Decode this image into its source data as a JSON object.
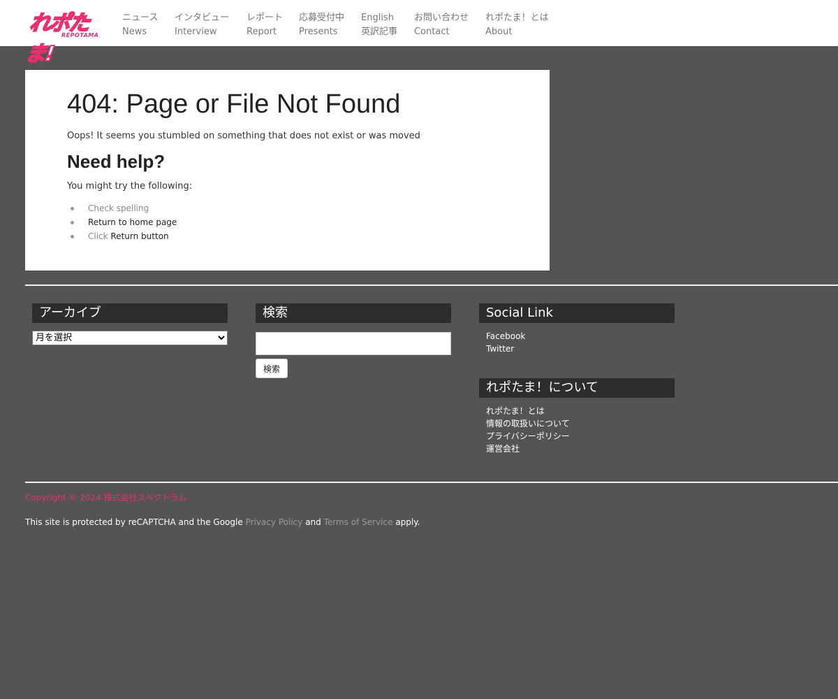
{
  "header": {
    "logo_text": "れポたま!",
    "logo_sub": "REPOTAMA",
    "nav": [
      {
        "jp": "ニュース",
        "en": "News"
      },
      {
        "jp": "インタビュー",
        "en": "Interview"
      },
      {
        "jp": "レポート",
        "en": "Report"
      },
      {
        "jp": "応募受付中",
        "en": "Presents"
      },
      {
        "jp": "English",
        "en": "英訳記事"
      },
      {
        "jp": "お問い合わせ",
        "en": "Contact"
      },
      {
        "jp": "れポたま！とは",
        "en": "About"
      }
    ]
  },
  "main": {
    "title": "404: Page or File Not Found",
    "oops": "Oops! It seems you stumbled on something that does not exist or was moved",
    "help_title": "Need help?",
    "try_text": "You might try the following:",
    "suggestions": [
      {
        "text": "Check spelling"
      },
      {
        "text": "Return to home page"
      },
      {
        "prefix": "Click",
        "link": "Return button"
      }
    ]
  },
  "widgets": {
    "archive": {
      "title": "アーカイブ",
      "select_value": "月を選択"
    },
    "search": {
      "title": "検索",
      "input_value": "",
      "button_label": "検索"
    },
    "social": {
      "title": "Social Link",
      "links": [
        "Facebook",
        "Twitter"
      ]
    },
    "about": {
      "title": "れポたま！について",
      "links": [
        "れポたま！とは",
        "情報の取扱いについて",
        "プライバシーポリシー",
        "運営会社"
      ]
    }
  },
  "footer": {
    "copyright": "Copyright © 2024 株式会社スペクトラム",
    "recaptcha_prefix": "This site is protected by reCAPTCHA and the Google",
    "privacy_link": "Privacy Policy",
    "and": "and",
    "terms_link": "Terms of Service",
    "apply": "apply."
  },
  "colors": {
    "brand_pink": "#e8306f",
    "page_background": "#545454",
    "widget_title_background": "#2d2d2d"
  }
}
